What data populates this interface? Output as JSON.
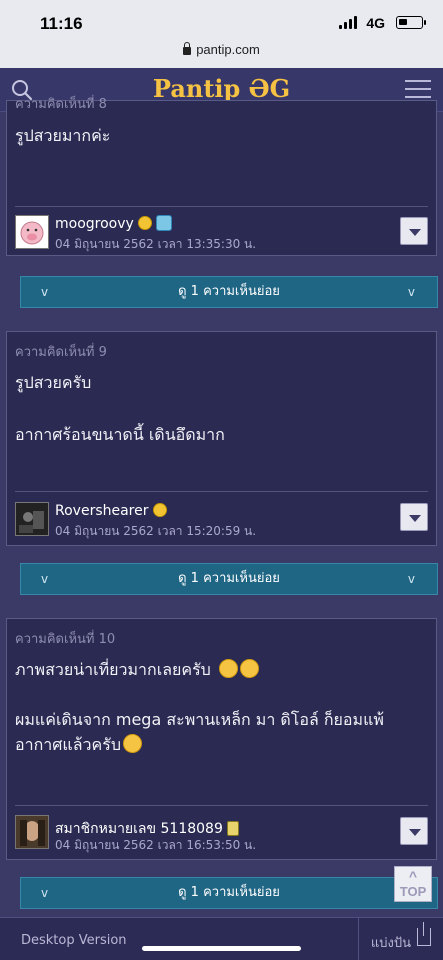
{
  "status_bar": {
    "time": "11:16",
    "network": "4G",
    "url": "pantip.com"
  },
  "header": {
    "logo": "Pantip ƏG"
  },
  "comments": [
    {
      "number": "ความคิดเห็นที่ 8",
      "paragraphs": [
        "รูปสวยมากค่ะ"
      ],
      "username": "moogroovy",
      "date": "04 มิถุนายน 2562 เวลา 13:35:30 น."
    },
    {
      "number": "ความคิดเห็นที่ 9",
      "paragraphs": [
        "รูปสวยครับ",
        "อากาศร้อนขนาดนี้ เดินอึดมาก"
      ],
      "username": "Rovershearer",
      "date": "04 มิถุนายน 2562 เวลา 15:20:59 น."
    },
    {
      "number": "ความคิดเห็นที่ 10",
      "paragraphs": [
        "ภาพสวยน่าเที่ยวมากเลยครับ",
        "ผมแค่เดินจาก mega สะพานเหล็ก มา ดิโอล์ ก็ยอมแพ้อากาศแล้วครับ"
      ],
      "username": "สมาชิกหมายเลข 5118089",
      "date": "04 มิถุนายน 2562 เวลา 16:53:50 น."
    }
  ],
  "reply_label": "ดู 1 ความเห็นย่อย",
  "top_button": "TOP",
  "bottom_bar": {
    "desktop_version": "Desktop Version",
    "share": "แบ่งปัน"
  }
}
